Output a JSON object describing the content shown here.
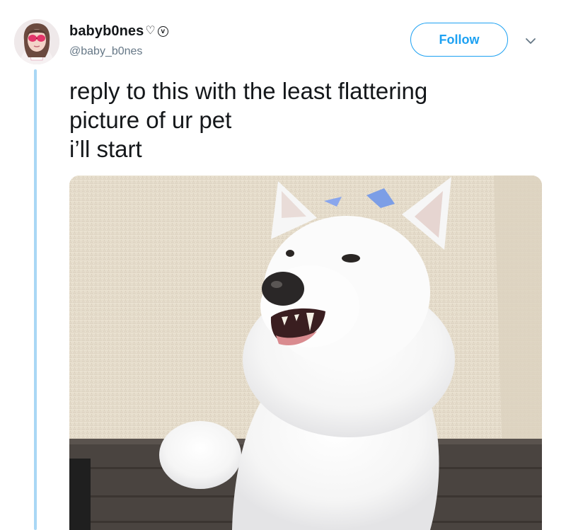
{
  "tweet": {
    "display_name": "babyb0nes",
    "name_emoji": "♡",
    "name_v": "v",
    "handle": "@baby_b0nes",
    "follow_label": "Follow",
    "text_lines": [
      "reply to this with the least flattering",
      "picture of ur pet",
      "i’ll start"
    ]
  },
  "colors": {
    "accent": "#1da1f2",
    "thread_line": "#a9d7f5",
    "text": "#14171a",
    "secondary_text": "#657786"
  },
  "icons": {
    "more_options": "chevron-down-icon"
  }
}
